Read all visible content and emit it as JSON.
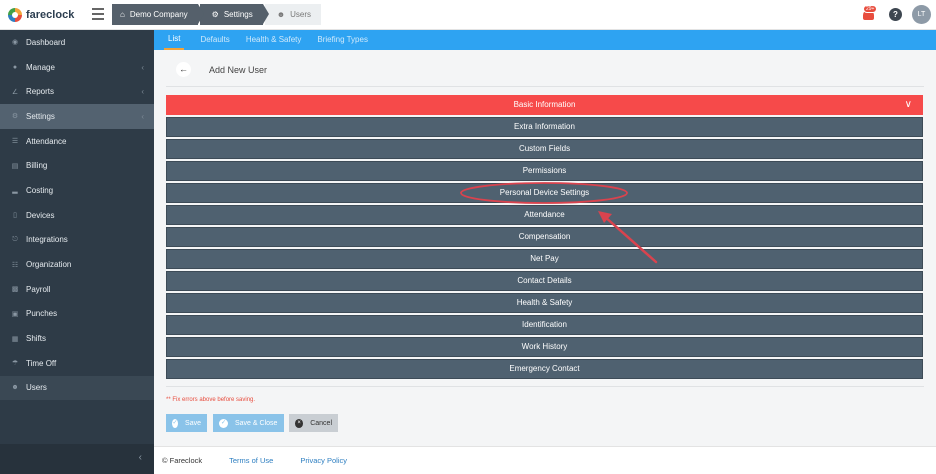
{
  "app": {
    "logo_text": "fareclock"
  },
  "breadcrumb": [
    {
      "label": "Demo Company",
      "icon": "home-icon"
    },
    {
      "label": "Settings",
      "icon": "gear-icon"
    },
    {
      "label": "Users",
      "icon": "users-icon"
    }
  ],
  "header": {
    "notification_count": "29+",
    "help_label": "?",
    "avatar_initials": "LT"
  },
  "sidebar": {
    "items": [
      {
        "label": "Dashboard",
        "icon": "dashboard-icon"
      },
      {
        "label": "Manage",
        "icon": "person-icon",
        "has_caret": true
      },
      {
        "label": "Reports",
        "icon": "chart-icon",
        "has_caret": true
      },
      {
        "label": "Settings",
        "icon": "gear-icon",
        "has_caret": true,
        "active": true
      },
      {
        "label": "Attendance",
        "icon": "list-icon"
      },
      {
        "label": "Billing",
        "icon": "billing-icon"
      },
      {
        "label": "Costing",
        "icon": "bar-chart-icon"
      },
      {
        "label": "Devices",
        "icon": "device-icon"
      },
      {
        "label": "Integrations",
        "icon": "plug-icon"
      },
      {
        "label": "Organization",
        "icon": "org-icon"
      },
      {
        "label": "Payroll",
        "icon": "money-icon"
      },
      {
        "label": "Punches",
        "icon": "punch-icon"
      },
      {
        "label": "Shifts",
        "icon": "calendar-icon"
      },
      {
        "label": "Time Off",
        "icon": "beach-icon"
      },
      {
        "label": "Users",
        "icon": "users-icon"
      }
    ],
    "collapse_icon": "chevron-left-icon"
  },
  "tabs": [
    {
      "label": "List",
      "active": true
    },
    {
      "label": "Defaults"
    },
    {
      "label": "Health & Safety"
    },
    {
      "label": "Briefing Types"
    }
  ],
  "page": {
    "title": "Add New User",
    "back_icon": "arrow-left-icon"
  },
  "sections": [
    "Basic Information",
    "Extra Information",
    "Custom Fields",
    "Permissions",
    "Personal Device Settings",
    "Attendance",
    "Compensation",
    "Net Pay",
    "Contact Details",
    "Health & Safety",
    "Identification",
    "Work History",
    "Emergency Contact"
  ],
  "form": {
    "error_text": "** Fix errors above before saving.",
    "save_label": "Save",
    "save_close_label": "Save & Close",
    "cancel_label": "Cancel"
  },
  "footer": {
    "copyright": "© Fareclock",
    "terms": "Terms of Use",
    "privacy": "Privacy Policy"
  },
  "colors": {
    "accent_blue": "#2ea3f2",
    "section_active": "#f64a4a",
    "section_default": "#4f6170",
    "sidebar_bg": "#2e3b47",
    "annotation_red": "#d9434e"
  }
}
